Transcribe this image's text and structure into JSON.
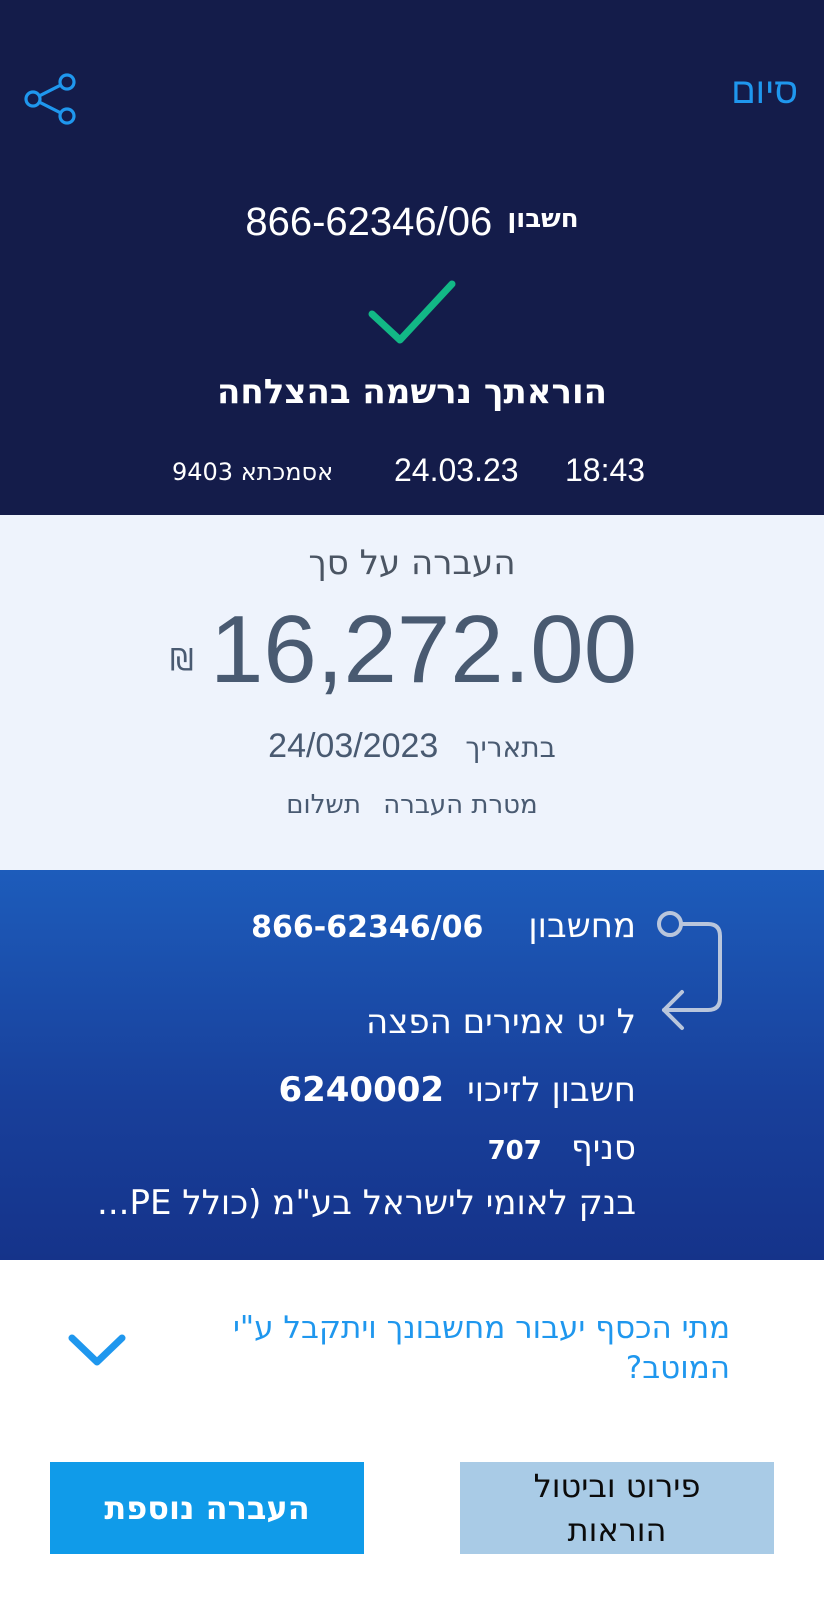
{
  "header": {
    "done_label": "סיום",
    "account_label": "חשבון",
    "account_number": "866-62346/06",
    "success_title": "הוראתך נרשמה בהצלחה",
    "time": "18:43",
    "date": "24.03.23",
    "reference": "אסמכתא 9403"
  },
  "amount": {
    "title": "העברה על סך",
    "value": "16,272.00",
    "currency": "₪",
    "date_label": "בתאריך",
    "date_value": "24/03/2023",
    "purpose_label": "מטרת העברה",
    "purpose_value": "תשלום"
  },
  "details": {
    "from_label": "מחשבון",
    "from_account": "866-62346/06",
    "to_line": "ל יט אמירים הפצה",
    "credit_label": "חשבון לזיכוי",
    "credit_account": "6240002",
    "branch_label": "סניף",
    "branch_number": "707",
    "bank_name": "בנק לאומי לישראל בע\"מ (כולל PE..."
  },
  "faq": {
    "question": "מתי הכסף יעבור מחשבונך ויתקבל ע\"י המוטב?"
  },
  "actions": {
    "details_cancel_label": "פירוט וביטול הוראות",
    "another_transfer_label": "העברה נוספת"
  },
  "colors": {
    "header_bg": "#141c4a",
    "accent_blue": "#1f97ee",
    "success_green": "#12b886",
    "amount_bg": "#eef3fc",
    "details_bg": "#1d5cbb",
    "primary_button": "#109be9",
    "secondary_button": "#a9cbe6"
  },
  "icons": {
    "share": "share-icon",
    "success": "checkmark-icon",
    "transfer": "transfer-arrow-icon",
    "expand": "chevron-down-icon"
  }
}
